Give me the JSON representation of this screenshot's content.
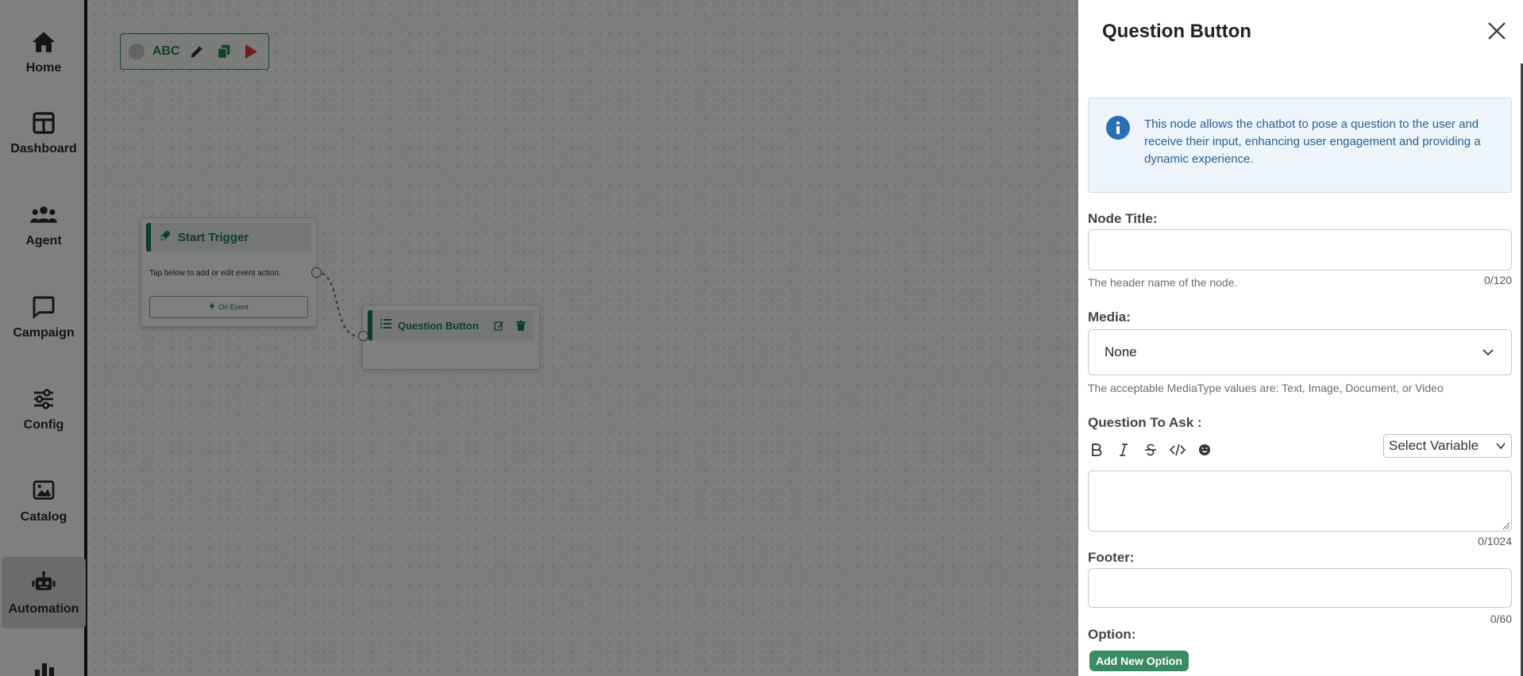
{
  "sidebar": {
    "items": [
      {
        "label": "Home",
        "icon": "home-icon"
      },
      {
        "label": "Dashboard",
        "icon": "dashboard-icon"
      },
      {
        "label": "Agent",
        "icon": "agent-icon"
      },
      {
        "label": "Campaign",
        "icon": "campaign-icon"
      },
      {
        "label": "Config",
        "icon": "config-icon"
      },
      {
        "label": "Catalog",
        "icon": "catalog-icon"
      },
      {
        "label": "Automation",
        "icon": "automation-icon",
        "active": true
      }
    ]
  },
  "toolbar": {
    "flow_name": "ABC",
    "icons": [
      "edit-icon",
      "copy-icon",
      "play-icon"
    ]
  },
  "canvas": {
    "trigger_node": {
      "title": "Start Trigger",
      "description": "Tap below to add or edit event action.",
      "button_label": "On Event"
    },
    "question_node": {
      "title": "Question Button"
    }
  },
  "panel": {
    "title": "Question Button",
    "info_text": "This node allows the chatbot to pose a question to the user and receive their input, enhancing user engagement and providing a dynamic experience.",
    "node_title": {
      "label": "Node Title:",
      "value": "",
      "helper": "The header name of the node.",
      "counter": "0/120"
    },
    "media": {
      "label": "Media:",
      "selected": "None",
      "helper": "The acceptable MediaType values are: Text, Image, Document, or Video"
    },
    "question": {
      "label": "Question To Ask :",
      "variable_select": "Select Variable",
      "counter": "0/1024",
      "format_tools": [
        "bold-icon",
        "italic-icon",
        "strikethrough-icon",
        "code-icon",
        "emoji-icon"
      ]
    },
    "footer": {
      "label": "Footer:",
      "counter": "0/60"
    },
    "option": {
      "label": "Option:",
      "add_button": "Add New Option"
    }
  },
  "colors": {
    "brand_green": "#2e8b57",
    "info_blue": "#2a6fb4",
    "play_red": "#e53935"
  }
}
